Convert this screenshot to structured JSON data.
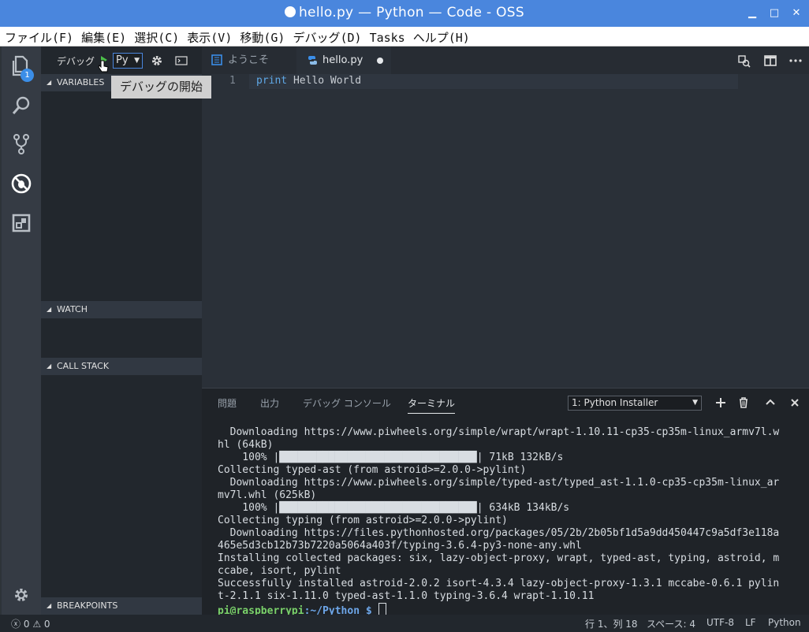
{
  "window": {
    "title": "hello.py — Python — Code - OSS",
    "controls": [
      "✕",
      "□",
      "_"
    ]
  },
  "menu": [
    "ファイル(F)",
    "編集(E)",
    "選択(C)",
    "表示(V)",
    "移動(G)",
    "デバッグ(D)",
    "Tasks",
    "ヘルプ(H)"
  ],
  "activity": {
    "explorer_badge": "1"
  },
  "debug": {
    "label": "デバッグ",
    "config": "Py",
    "tooltip": "デバッグの開始"
  },
  "sidebar": {
    "variables": "VARIABLES",
    "watch": "WATCH",
    "call_stack": "CALL STACK",
    "breakpoints": "BREAKPOINTS"
  },
  "tabs": [
    {
      "label": "ようこそ"
    },
    {
      "label": "hello.py"
    }
  ],
  "editor": {
    "line_number": "1",
    "code_keyword": "print",
    "code_rest": " Hello World"
  },
  "panel": {
    "tabs": [
      "問題",
      "出力",
      "デバッグ コンソール",
      "ターミナル"
    ],
    "active_tab_index": 3,
    "terminal_select": "1: Python Installer",
    "lines": [
      "  Downloading https://www.piwheels.org/simple/wrapt/wrapt-1.10.11-cp35-cp35m-linux_armv7l.w",
      "hl (64kB)",
      "    100% |████████████████████████████████| 71kB 132kB/s",
      "Collecting typed-ast (from astroid>=2.0.0->pylint)",
      "  Downloading https://www.piwheels.org/simple/typed-ast/typed_ast-1.1.0-cp35-cp35m-linux_ar",
      "mv7l.whl (625kB)",
      "    100% |████████████████████████████████| 634kB 134kB/s",
      "Collecting typing (from astroid>=2.0.0->pylint)",
      "  Downloading https://files.pythonhosted.org/packages/05/2b/2b05bf1d5a9dd450447c9a5df3e118a",
      "465e5d3cb12b73b7220a5064a403f/typing-3.6.4-py3-none-any.whl",
      "Installing collected packages: six, lazy-object-proxy, wrapt, typed-ast, typing, astroid, m",
      "ccabe, isort, pylint",
      "Successfully installed astroid-2.0.2 isort-4.3.4 lazy-object-proxy-1.3.1 mccabe-0.6.1 pylin",
      "t-2.1.1 six-1.11.0 typed-ast-1.1.0 typing-3.6.4 wrapt-1.10.11"
    ],
    "prompt_user": "pi@raspberrypi",
    "prompt_path": ":~/Python $ "
  },
  "status": {
    "errors": "0",
    "warnings": "0",
    "position": "行 1、列 18",
    "spaces": "スペース: 4",
    "encoding": "UTF-8",
    "eol": "LF",
    "language": "Python"
  }
}
